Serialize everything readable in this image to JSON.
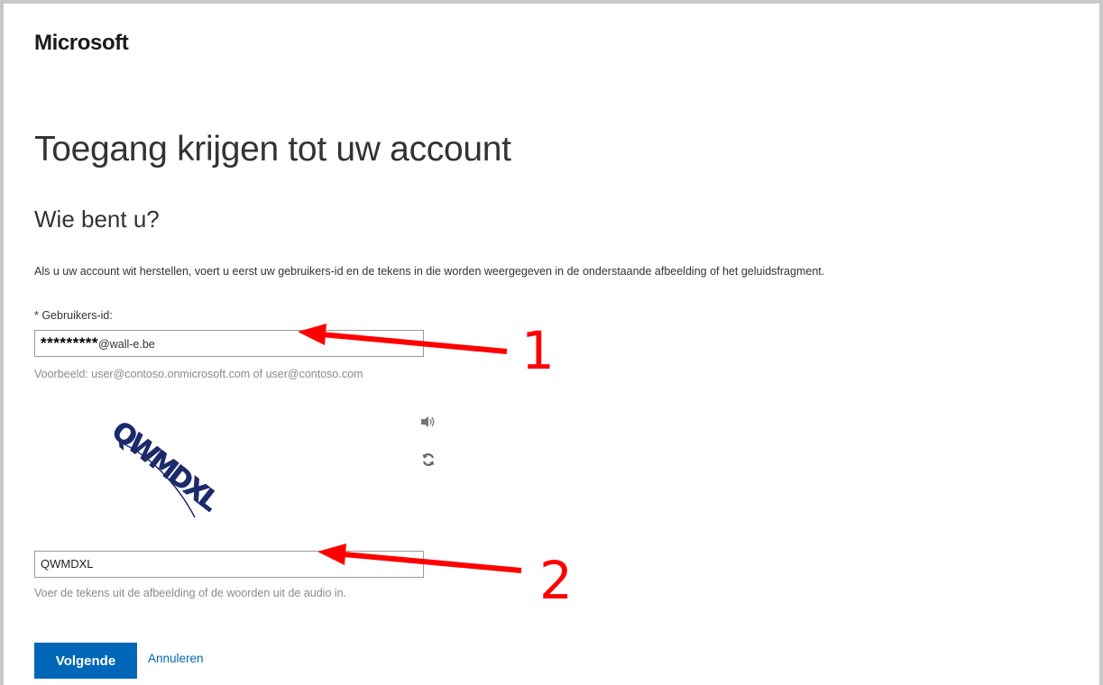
{
  "header": {
    "brand": "Microsoft"
  },
  "page": {
    "title": "Toegang krijgen tot uw account",
    "subtitle": "Wie bent u?",
    "instructions": "Als u uw account wit herstellen, voert u eerst uw gebruikers-id en de tekens in die worden weergegeven in de onderstaande afbeelding of het geluidsfragment."
  },
  "user_id": {
    "label": "* Gebruikers-id:",
    "value_masked": "*********",
    "value_domain": "@wall-e.be",
    "hint": "Voorbeeld: user@contoso.onmicrosoft.com of user@contoso.com"
  },
  "captcha": {
    "image_text": "QWMDXL",
    "audio_icon": "speaker-icon",
    "refresh_icon": "refresh-icon",
    "input_value": "QWMDXL",
    "hint": "Voer de tekens uit de afbeelding of de woorden uit de audio in."
  },
  "actions": {
    "next_label": "Volgende",
    "cancel_label": "Annuleren"
  },
  "annotations": {
    "label_1": "1",
    "label_2": "2",
    "color": "#ff0000"
  },
  "colors": {
    "accent": "#0067b8",
    "border": "#c8c8c8"
  }
}
